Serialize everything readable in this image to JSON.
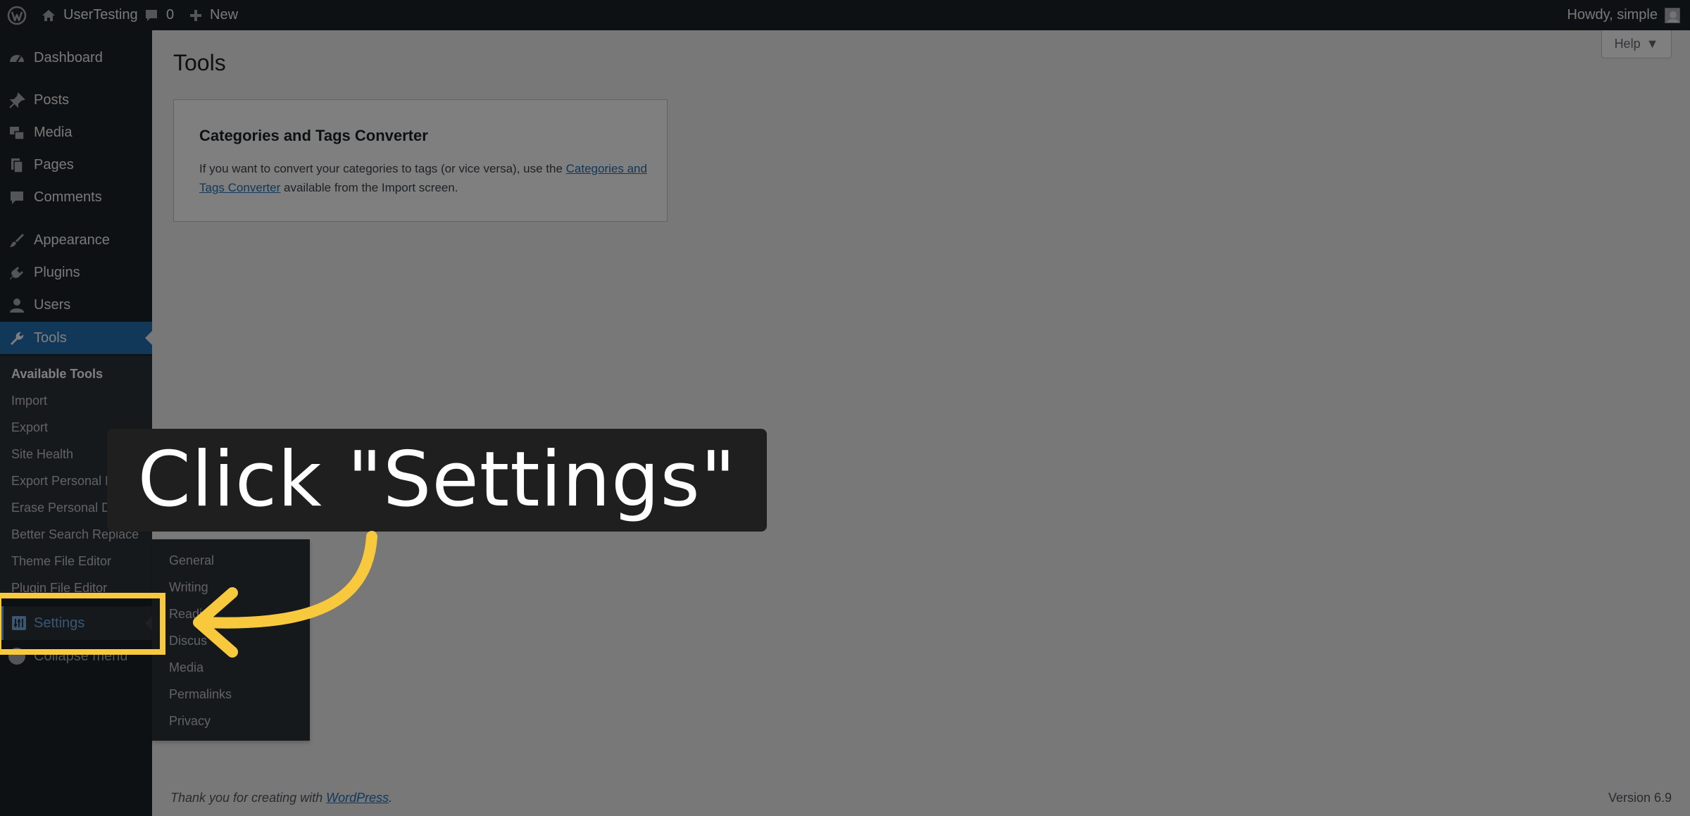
{
  "adminbar": {
    "site_name": "UserTesting",
    "comments_count": "0",
    "new_label": "New",
    "howdy": "Howdy, simple"
  },
  "menu": {
    "items": [
      {
        "label": "Dashboard",
        "icon": "dashboard-icon"
      },
      {
        "label": "Posts",
        "icon": "pin-icon"
      },
      {
        "label": "Media",
        "icon": "media-icon"
      },
      {
        "label": "Pages",
        "icon": "pages-icon"
      },
      {
        "label": "Comments",
        "icon": "comment-icon"
      },
      {
        "label": "Appearance",
        "icon": "brush-icon"
      },
      {
        "label": "Plugins",
        "icon": "plugin-icon"
      },
      {
        "label": "Users",
        "icon": "user-icon"
      },
      {
        "label": "Tools",
        "icon": "wrench-icon"
      }
    ],
    "tools_submenu": [
      "Available Tools",
      "Import",
      "Export",
      "Site Health",
      "Export Personal Da",
      "Erase Personal Data",
      "Better Search Replace",
      "Theme File Editor",
      "Plugin File Editor"
    ],
    "settings_label": "Settings",
    "collapse_label": "Collapse menu"
  },
  "settings_flyout": [
    "General",
    "Writing",
    "Readi",
    "Discus",
    "Media",
    "Permalinks",
    "Privacy"
  ],
  "content": {
    "help_label": "Help",
    "page_title": "Tools",
    "card_title": "Categories and Tags Converter",
    "card_text_before": "If you want to convert your categories to tags (or vice versa), use the ",
    "card_link": "Categories and Tags Converter",
    "card_text_after": " available from the Import screen."
  },
  "footer": {
    "thanks_text": "Thank you for creating with ",
    "wordpress_link": "WordPress",
    "thanks_end": ".",
    "version": "Version 6.9"
  },
  "overlay": {
    "instruction": "Click \"Settings\"",
    "accent_color": "#f8c93c"
  }
}
